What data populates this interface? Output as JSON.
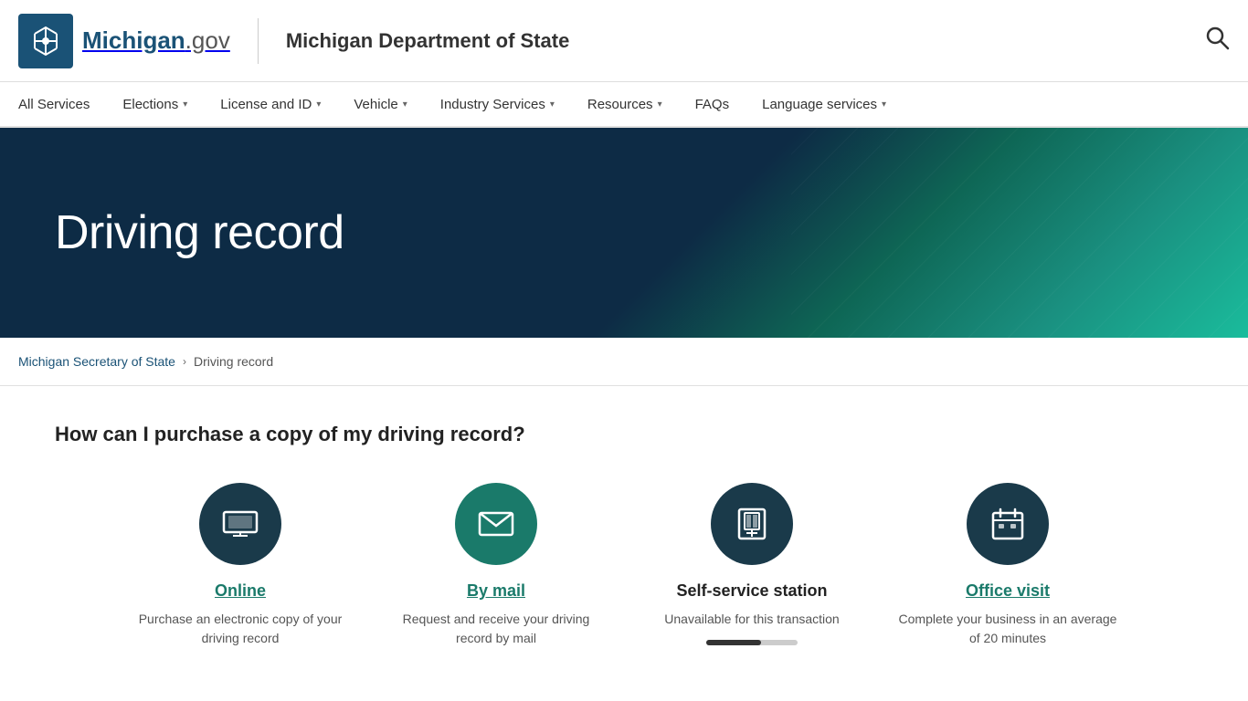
{
  "header": {
    "logo_text": "Michigan",
    "logo_gov": ".gov",
    "dept_name": "Michigan Department of State",
    "search_label": "Search"
  },
  "nav": {
    "items": [
      {
        "label": "All Services",
        "has_dropdown": false,
        "id": "all-services"
      },
      {
        "label": "Elections",
        "has_dropdown": true,
        "id": "elections"
      },
      {
        "label": "License and ID",
        "has_dropdown": true,
        "id": "license-id"
      },
      {
        "label": "Vehicle",
        "has_dropdown": true,
        "id": "vehicle"
      },
      {
        "label": "Industry Services",
        "has_dropdown": true,
        "id": "industry-services"
      },
      {
        "label": "Resources",
        "has_dropdown": true,
        "id": "resources"
      },
      {
        "label": "FAQs",
        "has_dropdown": false,
        "id": "faqs"
      },
      {
        "label": "Language services",
        "has_dropdown": true,
        "id": "language-services"
      }
    ]
  },
  "hero": {
    "title": "Driving record"
  },
  "breadcrumb": {
    "home_label": "Michigan Secretary of State",
    "separator": "›",
    "current": "Driving record"
  },
  "main": {
    "section_title": "How can I purchase a copy of my driving record?",
    "service_options": [
      {
        "id": "online",
        "icon": "🖥",
        "title": "Online",
        "is_link": true,
        "description": "Purchase an electronic copy of your driving record"
      },
      {
        "id": "by-mail",
        "icon": "✉",
        "title": "By mail",
        "is_link": true,
        "description": "Request and receive your driving record by mail"
      },
      {
        "id": "self-service",
        "icon": "▐▌",
        "title": "Self-service station",
        "is_link": false,
        "description": "Unavailable for this transaction",
        "has_progress": true
      },
      {
        "id": "office-visit",
        "icon": "📅",
        "title": "Office visit",
        "is_link": true,
        "description": "Complete your business in an average of 20 minutes"
      }
    ]
  }
}
